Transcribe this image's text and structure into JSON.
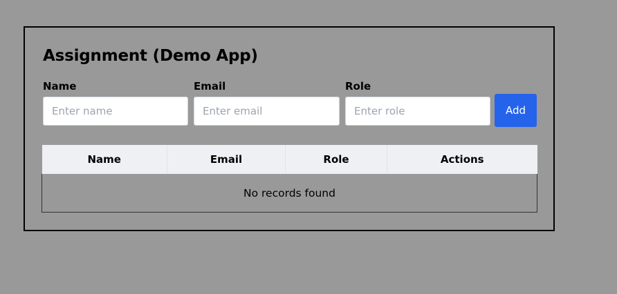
{
  "app": {
    "title": "Assignment (Demo App)"
  },
  "form": {
    "name": {
      "label": "Name",
      "placeholder": "Enter name",
      "value": ""
    },
    "email": {
      "label": "Email",
      "placeholder": "Enter email",
      "value": ""
    },
    "role": {
      "label": "Role",
      "placeholder": "Enter role",
      "value": ""
    },
    "add_label": "Add"
  },
  "table": {
    "columns": [
      "Name",
      "Email",
      "Role",
      "Actions"
    ],
    "rows": [],
    "empty_message": "No records found"
  },
  "colors": {
    "background": "#999999",
    "primary_button": "#2563eb",
    "table_header": "#eff0f4"
  }
}
